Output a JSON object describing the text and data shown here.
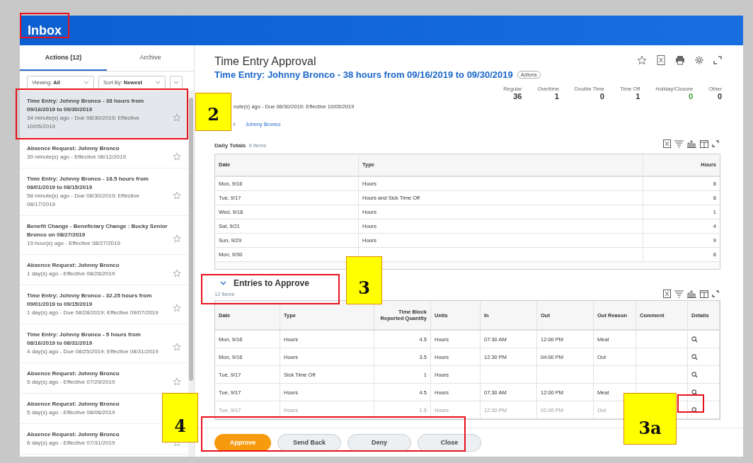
{
  "header": {
    "title": "Inbox"
  },
  "tabs": [
    {
      "label": "Actions (12)",
      "selected": true
    },
    {
      "label": "Archive",
      "selected": false
    }
  ],
  "filters": [
    {
      "label": "Viewing:",
      "value": "All"
    },
    {
      "label": "Sort By:",
      "value": "Newest"
    }
  ],
  "inbox_items": [
    {
      "title": "Time Entry: Johnny Bronco - 38 hours from 09/16/2019 to 09/30/2019",
      "meta": "34 minute(s) ago - Due 08/30/2019; Effective 10/05/2019",
      "selected": true
    },
    {
      "title": "Absence Request: Johnny Bronco",
      "meta": "39 minute(s) ago - Effective 08/12/2019",
      "selected": false
    },
    {
      "title": "Time Entry: Johnny Bronco - 18.5 hours from 08/01/2019 to 08/15/2019",
      "meta": "58 minute(s) ago - Due 08/30/2019; Effective 08/17/2019",
      "selected": false
    },
    {
      "title": "Benefit Change - Beneficiary Change : Bucky Senior Bronco on 08/27/2019",
      "meta": "19 hour(s) ago - Effective 08/27/2019",
      "selected": false
    },
    {
      "title": "Absence Request: Johnny Bronco",
      "meta": "1 day(s) ago - Effective 08/26/2019",
      "selected": false
    },
    {
      "title": "Time Entry: Johnny Bronco - 32.25 hours from 09/01/2019 to 09/15/2019",
      "meta": "1 day(s) ago - Due 08/28/2019; Effective 09/07/2019",
      "selected": false
    },
    {
      "title": "Time Entry: Johnny Bronco - 5 hours from 08/16/2019 to 08/31/2019",
      "meta": "4 day(s) ago - Due 08/25/2019; Effective 08/31/2019",
      "selected": false
    },
    {
      "title": "Absence Request: Johnny Bronco",
      "meta": "5 day(s) ago - Effective 07/29/2019",
      "selected": false
    },
    {
      "title": "Absence Request: Johnny Bronco",
      "meta": "5 day(s) ago - Effective 08/06/2019",
      "selected": false
    },
    {
      "title": "Absence Request: Johnny Bronco",
      "meta": "6 day(s) ago - Effective 07/31/2019",
      "selected": false
    }
  ],
  "detail": {
    "title": "Time Entry Approval",
    "subtitle": "Time Entry: Johnny Bronco - 38 hours from 09/16/2019 to 09/30/2019",
    "actions_label": "Actions",
    "summary": [
      {
        "label": "Regular",
        "value": "36",
        "color": "#333333"
      },
      {
        "label": "Overtime",
        "value": "1",
        "color": "#333333"
      },
      {
        "label": "Double Time",
        "value": "0",
        "color": "#333333"
      },
      {
        "label": "Time Off",
        "value": "1",
        "color": "#333333"
      },
      {
        "label": "Holiday/Closure",
        "value": "0",
        "color": "#3c9a3c"
      },
      {
        "label": "Other",
        "value": "0",
        "color": "#333333"
      }
    ],
    "meta": "nute(s) ago - Due 08/30/2019; Effective 10/05/2019",
    "for_label": "r",
    "for_value": "Johnny Bronco"
  },
  "daily_totals": {
    "title": "Daily Totals",
    "count": "6 items",
    "columns": [
      "Date",
      "Type",
      "Hours"
    ],
    "rows": [
      [
        "Mon, 9/16",
        "Hours",
        "8"
      ],
      [
        "Tue, 9/17",
        "Hours and Sick Time Off",
        "8"
      ],
      [
        "Wed, 9/18",
        "Hours",
        "1"
      ],
      [
        "Sat, 9/21",
        "Hours",
        "4"
      ],
      [
        "Sun, 9/29",
        "Hours",
        "9"
      ],
      [
        "Mon, 9/30",
        "",
        "8"
      ]
    ]
  },
  "entries": {
    "title": "Entries to Approve",
    "count": "12 items",
    "columns": [
      "Date",
      "Type",
      "Time Block Reported Quantity",
      "Units",
      "In",
      "Out",
      "Out Reason",
      "Comment",
      "Details"
    ],
    "rows": [
      [
        "Mon, 9/16",
        "Hours",
        "4.5",
        "Hours",
        "07:30 AM",
        "12:00 PM",
        "Meal",
        ""
      ],
      [
        "Mon, 9/16",
        "Hours",
        "3.5",
        "Hours",
        "12:30 PM",
        "04:00 PM",
        "Out",
        ""
      ],
      [
        "Tue, 9/17",
        "Sick Time Off",
        "1",
        "Hours",
        "",
        "",
        "",
        ""
      ],
      [
        "Tue, 9/17",
        "Hours",
        "4.5",
        "Hours",
        "07:30 AM",
        "12:00 PM",
        "Meal",
        ""
      ],
      [
        "Tue, 9/17",
        "Hours",
        "1.5",
        "Hours",
        "12:30 PM",
        "02:00 PM",
        "Out",
        ""
      ]
    ]
  },
  "buttons": [
    {
      "label": "Approve",
      "kind": "primary"
    },
    {
      "label": "Send Back",
      "kind": "secondary"
    },
    {
      "label": "Deny",
      "kind": "secondary"
    },
    {
      "label": "Close",
      "kind": "secondary"
    }
  ],
  "callouts": [
    {
      "label": "2",
      "kind": "label"
    },
    {
      "label": "3",
      "kind": "label"
    },
    {
      "label": "3a",
      "kind": "label"
    },
    {
      "label": "4",
      "kind": "label"
    }
  ]
}
